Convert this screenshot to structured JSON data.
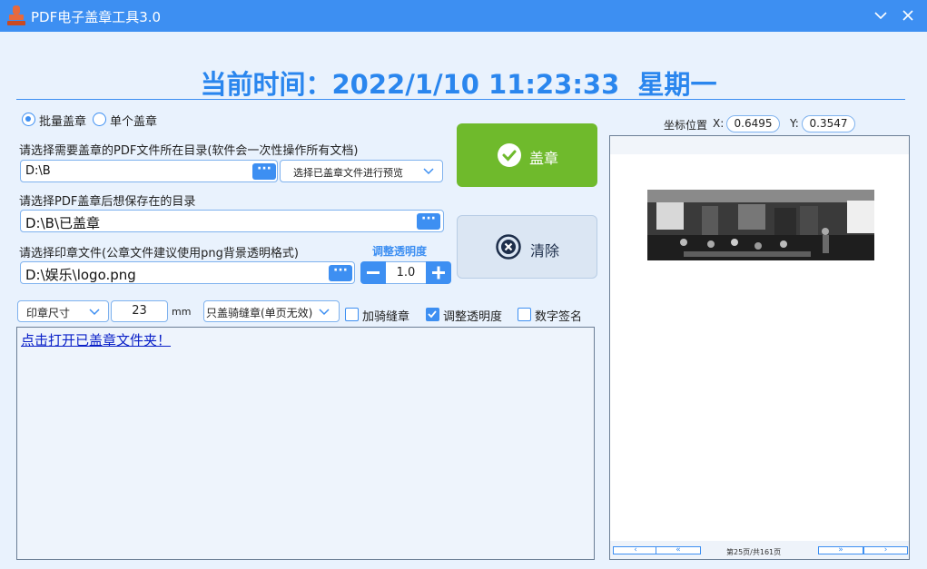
{
  "window": {
    "title": "PDF电子盖章工具3.0"
  },
  "clock": {
    "label": "当前时间：",
    "datetime": "2022/1/10 11:23:33",
    "weekday": "星期一"
  },
  "mode": {
    "batch_label": "批量盖章",
    "single_label": "单个盖章",
    "selected": "批量盖章"
  },
  "source": {
    "label": "请选择需要盖章的PDF文件所在目录(软件会一次性操作所有文档)",
    "path": "D:\\B",
    "preview_select": "选择已盖章文件进行预览"
  },
  "output": {
    "label": "请选择PDF盖章后想保存在的目录",
    "path": "D:\\B\\已盖章"
  },
  "seal": {
    "label": "请选择印章文件(公章文件建议使用png背景透明格式)",
    "path": "D:\\娱乐\\logo.png",
    "opacity_label": "调整透明度",
    "opacity_value": "1.0"
  },
  "options": {
    "size_select": "印章尺寸",
    "size_value": "23",
    "size_unit": "mm",
    "seam_select": "只盖骑缝章(单页无效)",
    "seam_label": "加骑缝章",
    "seam_checked": false,
    "opacity_label": "调整透明度",
    "opacity_checked": true,
    "signature_label": "数字签名",
    "signature_checked": false
  },
  "actions": {
    "stamp_label": "盖章",
    "clear_label": "清除"
  },
  "log": {
    "link_text": "点击打开已盖章文件夹！"
  },
  "preview": {
    "coord_label": "坐标位置",
    "x_label": "X:",
    "x_value": "0.6495",
    "y_label": "Y:",
    "y_value": "0.3547",
    "page_info": "第25页/共161页"
  },
  "colors": {
    "accent": "#3d8ff2",
    "stamp_button": "#6fba2c",
    "clock_text": "#2a86ee",
    "link": "#0a20c8"
  }
}
